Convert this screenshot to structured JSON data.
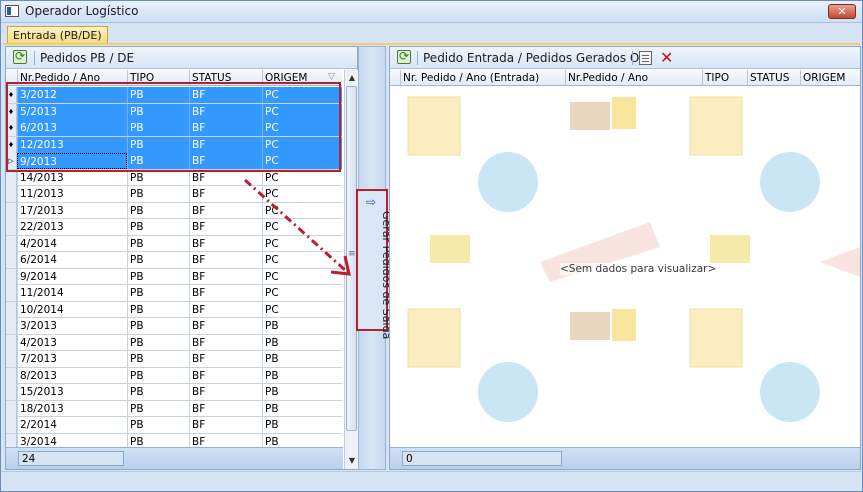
{
  "window": {
    "title": "Operador Logístico",
    "close_label": "✕"
  },
  "tabs": [
    {
      "label": "Entrada (PB/DE)"
    }
  ],
  "left_panel": {
    "title": "Pedidos PB / DE",
    "columns": [
      "Nr.Pedido / Ano",
      "TIPO",
      "STATUS",
      "ORIGEM"
    ],
    "rows": [
      {
        "pedido": "3/2012",
        "tipo": "PB",
        "status": "BF",
        "origem": "PC",
        "selected": true
      },
      {
        "pedido": "5/2013",
        "tipo": "PB",
        "status": "BF",
        "origem": "PC",
        "selected": true
      },
      {
        "pedido": "6/2013",
        "tipo": "PB",
        "status": "BF",
        "origem": "PC",
        "selected": true
      },
      {
        "pedido": "12/2013",
        "tipo": "PB",
        "status": "BF",
        "origem": "PC",
        "selected": true
      },
      {
        "pedido": "9/2013",
        "tipo": "PB",
        "status": "BF",
        "origem": "PC",
        "selected": true
      },
      {
        "pedido": "14/2013",
        "tipo": "PB",
        "status": "BF",
        "origem": "PC"
      },
      {
        "pedido": "11/2013",
        "tipo": "PB",
        "status": "BF",
        "origem": "PC"
      },
      {
        "pedido": "17/2013",
        "tipo": "PB",
        "status": "BF",
        "origem": "PC"
      },
      {
        "pedido": "22/2013",
        "tipo": "PB",
        "status": "BF",
        "origem": "PC"
      },
      {
        "pedido": "4/2014",
        "tipo": "PB",
        "status": "BF",
        "origem": "PC"
      },
      {
        "pedido": "6/2014",
        "tipo": "PB",
        "status": "BF",
        "origem": "PC"
      },
      {
        "pedido": "9/2014",
        "tipo": "PB",
        "status": "BF",
        "origem": "PC"
      },
      {
        "pedido": "11/2014",
        "tipo": "PB",
        "status": "BF",
        "origem": "PC"
      },
      {
        "pedido": "10/2014",
        "tipo": "PB",
        "status": "BF",
        "origem": "PC"
      },
      {
        "pedido": "3/2013",
        "tipo": "PB",
        "status": "BF",
        "origem": "PB"
      },
      {
        "pedido": "4/2013",
        "tipo": "PB",
        "status": "BF",
        "origem": "PB"
      },
      {
        "pedido": "7/2013",
        "tipo": "PB",
        "status": "BF",
        "origem": "PB"
      },
      {
        "pedido": "8/2013",
        "tipo": "PB",
        "status": "BF",
        "origem": "PB"
      },
      {
        "pedido": "15/2013",
        "tipo": "PB",
        "status": "BF",
        "origem": "PB"
      },
      {
        "pedido": "18/2013",
        "tipo": "PB",
        "status": "BF",
        "origem": "PB"
      },
      {
        "pedido": "2/2014",
        "tipo": "PB",
        "status": "BF",
        "origem": "PB"
      },
      {
        "pedido": "3/2014",
        "tipo": "PB",
        "status": "BF",
        "origem": "PB"
      }
    ],
    "count": "24"
  },
  "generate_button": {
    "label": "Gerar Pedidos de Saída"
  },
  "right_panel": {
    "title": "Pedido Entrada / Pedidos Gerados O.L.",
    "columns": [
      "Nr. Pedido / Ano (Entrada)",
      "Nr.Pedido / Ano",
      "TIPO",
      "STATUS",
      "ORIGEM"
    ],
    "empty_message": "<Sem dados para visualizar>",
    "count": "0"
  }
}
